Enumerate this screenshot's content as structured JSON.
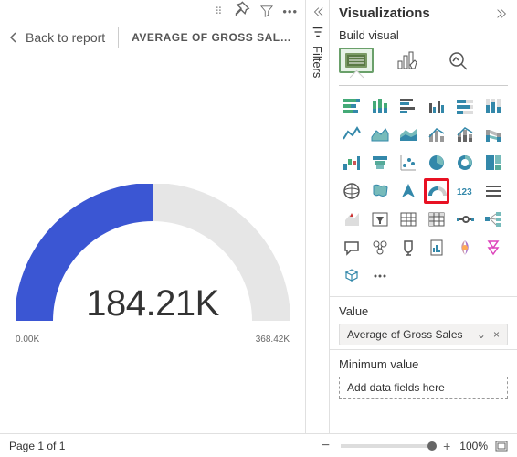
{
  "toolbar": {
    "grip": "⠿"
  },
  "header": {
    "back_label": "Back to report",
    "card_title": "AVERAGE OF GROSS SAL…"
  },
  "gauge": {
    "value_label": "184.21K",
    "min_label": "0.00K",
    "max_label": "368.42K"
  },
  "chart_data": {
    "type": "gauge",
    "value": 184.21,
    "min": 0,
    "max": 368.42,
    "unit": "K",
    "title": "AVERAGE OF GROSS SALES"
  },
  "filters_label": "Filters",
  "viz": {
    "title": "Visualizations",
    "build_label": "Build visual",
    "icons": [
      "stacked-bar",
      "stacked-column",
      "clustered-bar",
      "clustered-column",
      "100-stacked-bar",
      "100-stacked-col",
      "line",
      "area",
      "stacked-area",
      "line-col",
      "line-col-stacked",
      "ribbon",
      "waterfall",
      "funnel",
      "scatter",
      "pie",
      "donut",
      "treemap",
      "map",
      "filled-map",
      "azure-map",
      "gauge",
      "card",
      "multi-row",
      "kpi",
      "slicer",
      "table",
      "matrix",
      "r-visual",
      "decomp",
      "qna",
      "key-influencers",
      "goals",
      "paginated",
      "power-apps",
      "automate",
      "py",
      "more"
    ],
    "highlighted": "gauge",
    "value_section": "Value",
    "value_pill": "Average of Gross Sales",
    "min_section": "Minimum value",
    "min_placeholder": "Add data fields here"
  },
  "footer": {
    "page_label": "Page 1 of 1",
    "zoom_label": "100%"
  }
}
